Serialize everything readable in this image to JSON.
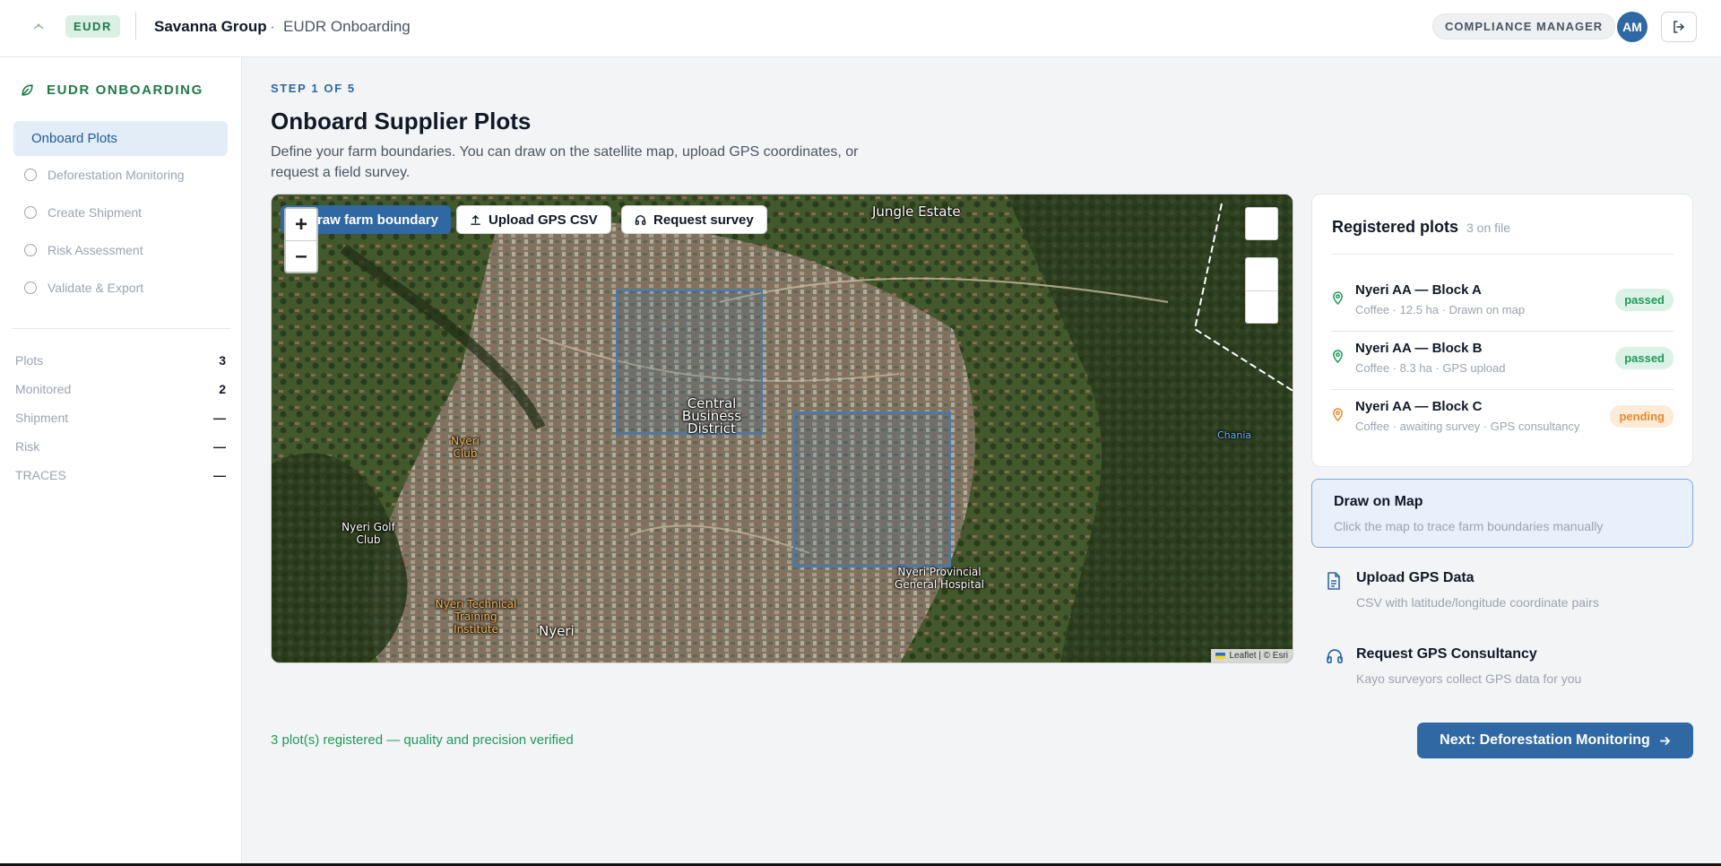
{
  "header": {
    "badge": "EUDR",
    "org": "Savanna Group",
    "separator": "·",
    "page": "EUDR Onboarding",
    "role": "COMPLIANCE MANAGER",
    "avatar_initials": "AM",
    "logout_icon": "logout-icon"
  },
  "sidebar": {
    "title": "EUDR ONBOARDING",
    "title_icon": "leaf-icon",
    "active_item": "Onboard Plots",
    "items": [
      {
        "label": "Deforestation Monitoring"
      },
      {
        "label": "Create Shipment"
      },
      {
        "label": "Risk Assessment"
      },
      {
        "label": "Validate & Export"
      }
    ],
    "stats": [
      {
        "label": "Plots",
        "value": "3"
      },
      {
        "label": "Monitored",
        "value": "2"
      },
      {
        "label": "Shipment",
        "value": "—"
      },
      {
        "label": "Risk",
        "value": "—"
      },
      {
        "label": "TRACES",
        "value": "—"
      }
    ]
  },
  "main": {
    "step": "STEP 1 OF 5",
    "title": "Onboard Supplier Plots",
    "description": "Define your farm boundaries. You can draw on the satellite map, upload GPS coordinates, or request a field survey."
  },
  "map": {
    "tools": {
      "draw": "Draw farm boundary",
      "upload": "Upload GPS CSV",
      "survey": "Request survey"
    },
    "zoom_in": "+",
    "zoom_out": "–",
    "labels": {
      "jungle_estate": "Jungle Estate",
      "cbd": "Central Business District",
      "nyeri_club": "Nyeri Club",
      "golf_club": "Nyeri Golf Club",
      "technical": "Nyeri Technical Training Institute",
      "nyeri": "Nyeri",
      "hospital": "Nyeri Provincial General Hospital",
      "chania": "Chania"
    },
    "attribution": "Leaflet | © Esri"
  },
  "registered": {
    "title": "Registered plots",
    "count": "3 on file",
    "plots": [
      {
        "name": "Nyeri AA — Block A",
        "meta": "Coffee · 12.5 ha · Drawn on map",
        "status": "passed"
      },
      {
        "name": "Nyeri AA — Block B",
        "meta": "Coffee · 8.3 ha · GPS upload",
        "status": "passed"
      },
      {
        "name": "Nyeri AA — Block C",
        "meta": "Coffee · awaiting survey · GPS consultancy",
        "status": "pending"
      }
    ]
  },
  "methods": {
    "draw": {
      "title": "Draw on Map",
      "desc": "Click the map to trace farm boundaries manually"
    },
    "upload": {
      "title": "Upload GPS Data",
      "desc": "CSV with latitude/longitude coordinate pairs",
      "icon": "file-icon"
    },
    "consult": {
      "title": "Request GPS Consultancy",
      "desc": "Kayo surveyors collect GPS data for you",
      "icon": "headset-icon"
    }
  },
  "footer": {
    "note": "3 plot(s) registered — quality and precision verified",
    "next": "Next: Deforestation Monitoring",
    "next_icon": "arrow-right-icon"
  },
  "colors": {
    "primary": "#2f68a3",
    "success": "#1f9a5a",
    "warning": "#e8892a",
    "brand_green": "#1f7a4a"
  }
}
